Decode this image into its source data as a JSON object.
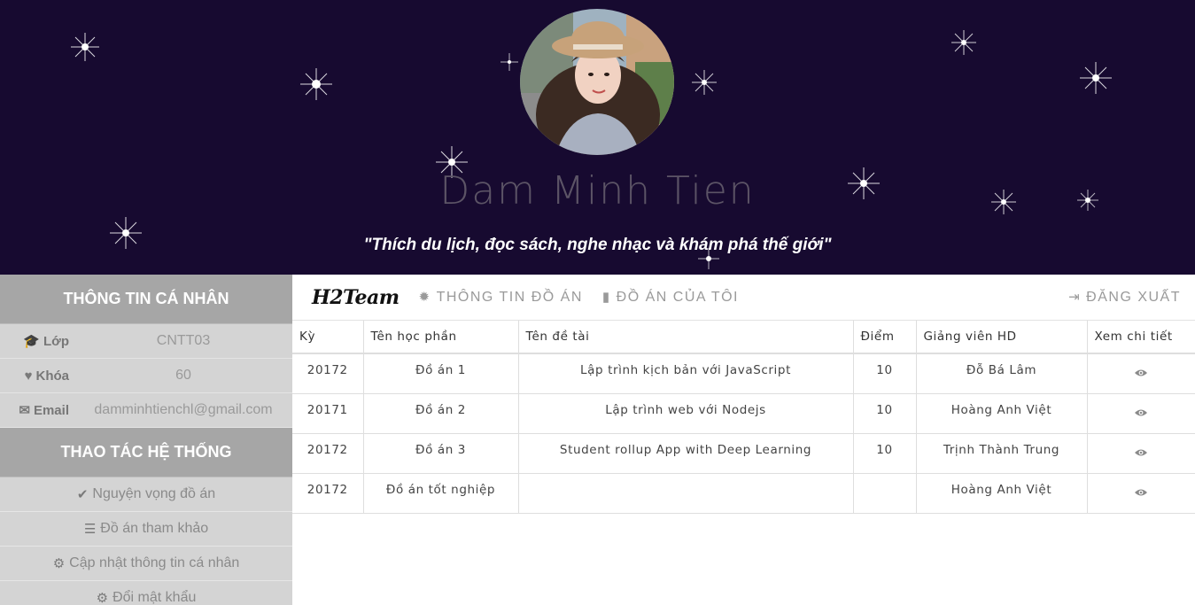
{
  "profile": {
    "name": "Dam Minh Tien",
    "quote": "\"Thích du lịch, đọc sách, nghe nhạc và khám phá thế giới\""
  },
  "sidebar": {
    "personal_title": "THÔNG TIN CÁ NHÂN",
    "info": [
      {
        "icon": "graduation-cap-icon",
        "label": "Lớp",
        "value": "CNTT03"
      },
      {
        "icon": "heart-icon",
        "label": "Khóa",
        "value": "60"
      },
      {
        "icon": "envelope-icon",
        "label": "Email",
        "value": "damminhtienchl@gmail.com"
      }
    ],
    "actions_title": "THAO TÁC HỆ THỐNG",
    "actions": [
      {
        "icon": "check-icon",
        "label": "Nguyện vọng đồ án"
      },
      {
        "icon": "list-icon",
        "label": "Đồ án tham khảo"
      },
      {
        "icon": "gear-icon",
        "label": "Cập nhật thông tin cá nhân"
      },
      {
        "icon": "gear-icon",
        "label": "Đổi mật khẩu"
      }
    ]
  },
  "navbar": {
    "brand": "H2Team",
    "items": [
      {
        "icon": "sun-icon",
        "label": "THÔNG TIN ĐỒ ÁN"
      },
      {
        "icon": "file-icon",
        "label": "ĐỒ ÁN CỦA TÔI"
      }
    ],
    "logout": {
      "icon": "sign-in-icon",
      "label": "ĐĂNG XUẤT"
    }
  },
  "table": {
    "headers": [
      "Kỳ",
      "Tên học phần",
      "Tên đề tài",
      "Điểm",
      "Giảng viên HD",
      "Xem chi tiết"
    ],
    "rows": [
      {
        "term": "20172",
        "course": "Đồ án 1",
        "topic": "Lập trình kịch bản với JavaScript",
        "score": "10",
        "advisor": "Đỗ Bá Lâm"
      },
      {
        "term": "20171",
        "course": "Đồ án 2",
        "topic": "Lập trình web với Nodejs",
        "score": "10",
        "advisor": "Hoàng Anh Việt"
      },
      {
        "term": "20172",
        "course": "Đồ án 3",
        "topic": "Student rollup App with Deep Learning",
        "score": "10",
        "advisor": "Trịnh Thành Trung"
      },
      {
        "term": "20172",
        "course": "Đồ án tốt nghiệp",
        "topic": "",
        "score": "",
        "advisor": "Hoàng Anh Việt"
      }
    ]
  },
  "colors": {
    "header_bg": "#170a30",
    "sidebar_head_bg": "#a6a6a6",
    "sidebar_bg": "#d4d4d4"
  }
}
